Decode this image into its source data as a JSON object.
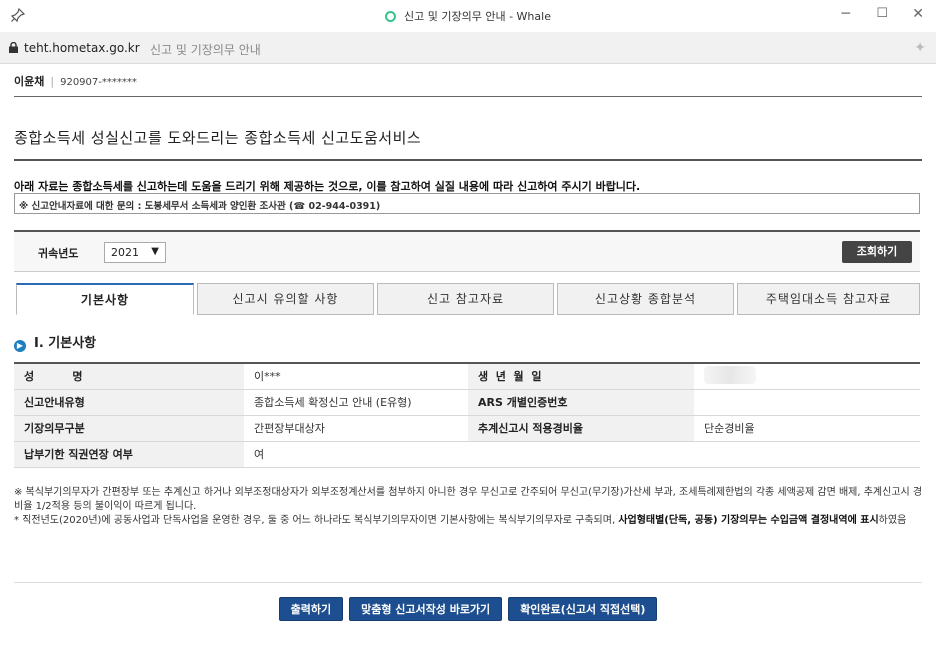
{
  "window": {
    "title": "신고 및 기장의무 안내 - Whale",
    "controls": {
      "minimize": "─",
      "maximize": "☐",
      "close": "✕"
    }
  },
  "addressbar": {
    "domain": "teht.hometax.go.kr",
    "page_title": "신고 및 기장의무 안내",
    "icons": {
      "lock": "lock-icon",
      "star": "star-icon"
    }
  },
  "user": {
    "name": "이윤채",
    "id": "920907-*******"
  },
  "headline": "종합소득세 성실신고를 도와드리는 종합소득세 신고도움서비스",
  "notice": "아래 자료는 종합소득세를 신고하는데 도움을 드리기 위해 제공하는 것으로, 이를 참고하여 실질 내용에 따라 신고하여 주시기 바랍니다.",
  "contact": "※ 신고안내자료에 대한 문의 : 도봉세무서 소득세과 양인환 조사관 (☎ 02-944-0391)",
  "search": {
    "year_label": "귀속년도",
    "year_value": "2021",
    "button": "조회하기"
  },
  "tabs": [
    {
      "label": "기본사항",
      "active": true
    },
    {
      "label": "신고시 유의할 사항",
      "active": false
    },
    {
      "label": "신고 참고자료",
      "active": false
    },
    {
      "label": "신고상황 종합분석",
      "active": false
    },
    {
      "label": "주택임대소득 참고자료",
      "active": false
    }
  ],
  "section": {
    "number": "▶",
    "title": "Ⅰ. 기본사항"
  },
  "info": {
    "rows": [
      {
        "h1": "성          명",
        "v1": "이***",
        "h2": "생  년  월  일",
        "v2": ""
      },
      {
        "h1": "신고안내유형",
        "v1": "종합소득세 확정신고 안내 (E유형)",
        "h2": "ARS 개별인증번호",
        "v2": ""
      },
      {
        "h1": "기장의무구분",
        "v1": "간편장부대상자",
        "h2": "추계신고시 적용경비율",
        "v2": "단순경비율"
      },
      {
        "h1": "납부기한 직권연장 여부",
        "v1": "여",
        "h2": "",
        "v2": ""
      }
    ]
  },
  "footnote": {
    "line1": "※ 복식부기의무자가 간편장부 또는 추계신고 하거나 외부조정대상자가 외부조정계산서를 첨부하지 아니한 경우 무신고로 간주되어 무신고(무기장)가산세 부과, 조세특례제한법의 각종 세액공제 감면 배제, 추계신고시 경비율 1/2적용 등의 불이익이 따르게 됩니다.",
    "line2_a": "* 직전년도(2020년)에 공동사업과 단독사업을 운영한 경우, 둘 중 어느 하나라도 복식부기의무자이면 기본사항에는 복식부기의무자로 구축되며, ",
    "line2_b": "사업형태별(단독, 공동) 기장의무는 수입금액 결정내역에 표시",
    "line2_c": "하였음"
  },
  "buttons": {
    "print": "출력하기",
    "custom": "맞춤형 신고서작성 바로가기",
    "confirm": "확인완료(신고서 직접선택)"
  },
  "colors": {
    "tab_active": "#2b6bb6",
    "button_primary": "#1d4e8f",
    "search_button": "#444444",
    "section_dot": "#1b7fc2"
  }
}
